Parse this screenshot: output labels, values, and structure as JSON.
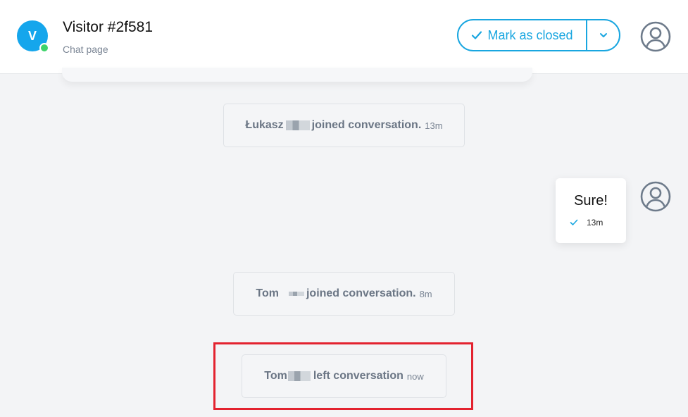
{
  "header": {
    "avatar_letter": "V",
    "visitor_name": "Visitor #2f581",
    "page_label": "Chat page",
    "mark_closed_label": "Mark as closed"
  },
  "icons": {
    "check": "check-icon",
    "dropdown": "chevron-down-icon",
    "user": "user-circle-icon"
  },
  "colors": {
    "accent": "#19a6e0",
    "online": "#3ed36a",
    "avatar": "#15a6ec",
    "highlight": "#e3222f"
  },
  "messages": {
    "lukasz_joined": {
      "name": "Łukasz",
      "action": "joined conversation.",
      "time": "13m"
    },
    "sure": {
      "text": "Sure!",
      "time": "13m"
    },
    "tom_joined": {
      "name": "Tom",
      "action": "joined conversation.",
      "time": "8m"
    },
    "tom_left": {
      "name": "Tom",
      "action": "left conversation",
      "time": "now"
    }
  }
}
